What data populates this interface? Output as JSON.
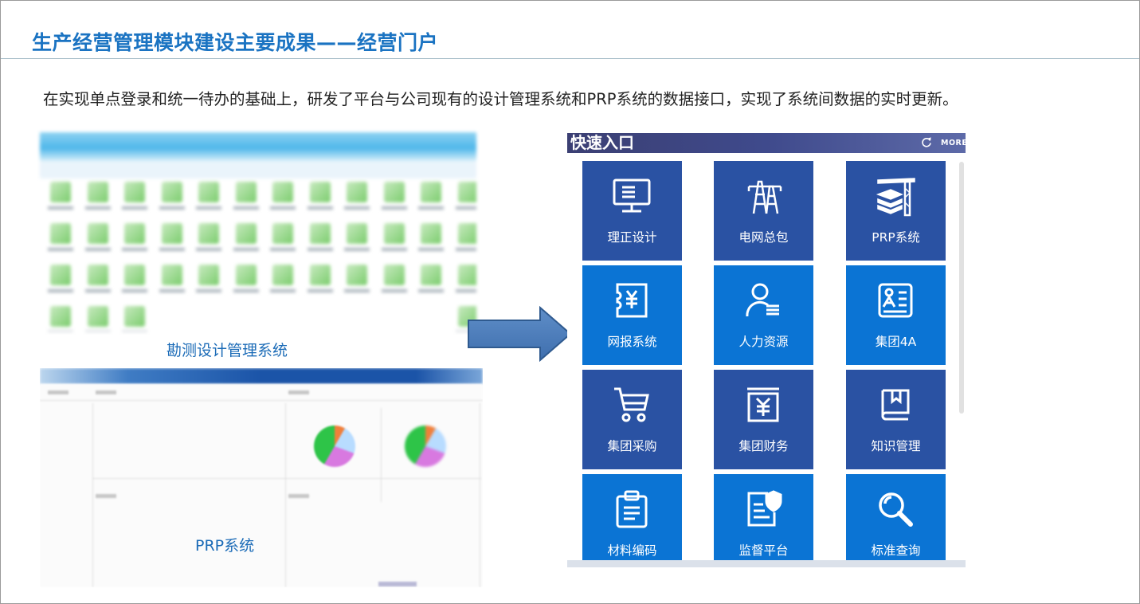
{
  "page": {
    "title": "生产经营管理模块建设主要成果——经营门户",
    "description": "在实现单点登录和统一待办的基础上，研发了平台与公司现有的设计管理系统和PRP系统的数据接口，实现了系统间数据的实时更新。"
  },
  "left": {
    "caption_survey": "勘测设计管理系统",
    "caption_prp": "PRP系统"
  },
  "panel": {
    "title": "快速入口",
    "more": "MORE",
    "refresh_icon": "refresh-icon"
  },
  "tiles": [
    {
      "label": "理正设计",
      "icon": "monitor-icon",
      "tone": "dark"
    },
    {
      "label": "电网总包",
      "icon": "power-tower-icon",
      "tone": "dark"
    },
    {
      "label": "PRP系统",
      "icon": "crane-building-icon",
      "tone": "dark"
    },
    {
      "label": "网报系统",
      "icon": "yuan-receipt-icon",
      "tone": "light"
    },
    {
      "label": "人力资源",
      "icon": "person-icon",
      "tone": "light"
    },
    {
      "label": "集团4A",
      "icon": "id-card-icon",
      "tone": "light"
    },
    {
      "label": "集团采购",
      "icon": "shopping-cart-icon",
      "tone": "dark"
    },
    {
      "label": "集团财务",
      "icon": "yuan-box-icon",
      "tone": "dark"
    },
    {
      "label": "知识管理",
      "icon": "book-icon",
      "tone": "dark"
    },
    {
      "label": "材料编码",
      "icon": "clipboard-icon",
      "tone": "light"
    },
    {
      "label": "监督平台",
      "icon": "shield-document-icon",
      "tone": "light"
    },
    {
      "label": "标准查询",
      "icon": "magnifier-icon",
      "tone": "light"
    }
  ],
  "colors": {
    "title": "#1a73c2",
    "tile_dark": "#2a52a3",
    "tile_light": "#0b74d4",
    "caption": "#1b6bb7"
  }
}
